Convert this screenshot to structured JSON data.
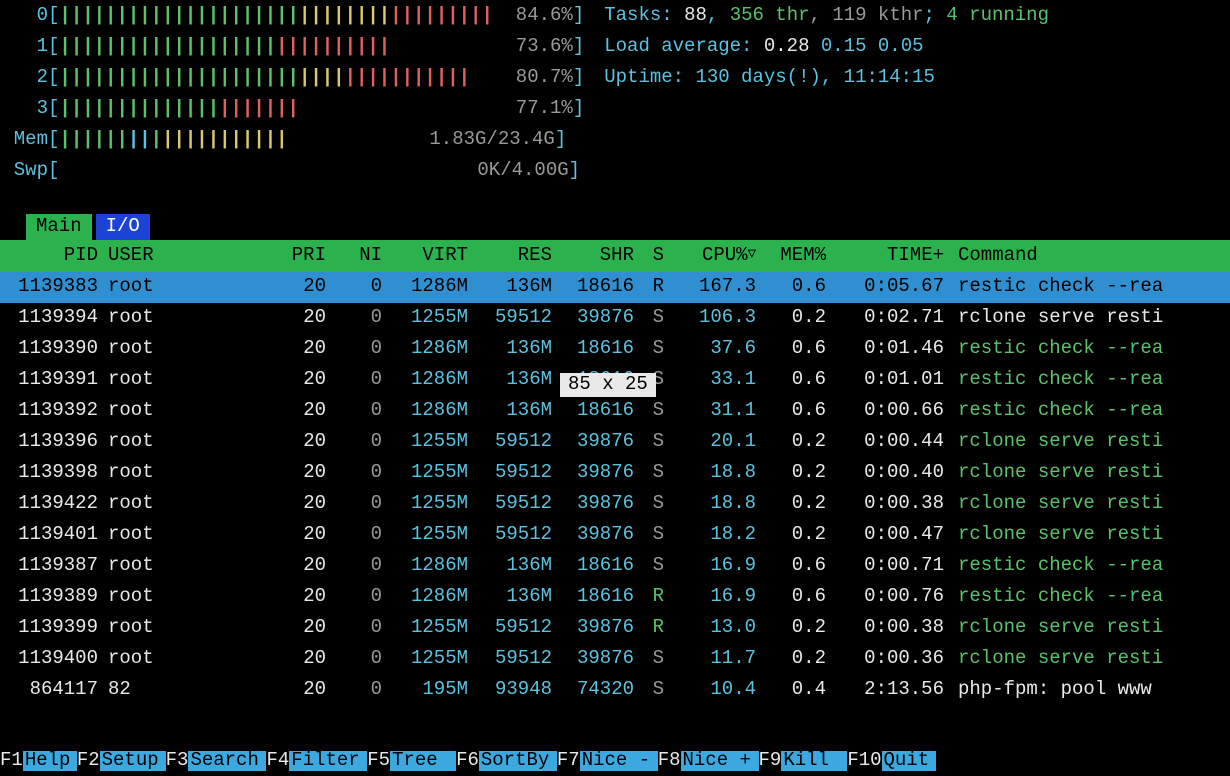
{
  "cpu": [
    {
      "label": "0",
      "pct": "84.6%",
      "bar": "GGGGGGGGGGGGGGGGGGGGGYYYYYYYYRRRRRRRRR"
    },
    {
      "label": "1",
      "pct": "73.6%",
      "bar": "GGGGGGGGGGGGGGGGGGGRRRRRRRRRR"
    },
    {
      "label": "2",
      "pct": "80.7%",
      "bar": "GGGGGGGGGGGGGGGGGGGGGYYYYRRRRRRRRRRR"
    },
    {
      "label": "3",
      "pct": "77.1%",
      "bar": "GGGGGGGGGGGGGGRRRRRRR"
    }
  ],
  "mem": {
    "label": "Mem",
    "used": "1.83G",
    "total": "23.4G",
    "bar": "GGGGGGBBGYYYYYYYYYYY"
  },
  "swp": {
    "label": "Swp",
    "used": "0K",
    "total": "4.00G"
  },
  "tasks": {
    "label": "Tasks:",
    "tasks": "88",
    "thr": "356 thr",
    "kthr": "119 kthr",
    "running": "4 running"
  },
  "load": {
    "label": "Load average:",
    "v1": "0.28",
    "v2": "0.15",
    "v3": "0.05"
  },
  "uptime": {
    "label": "Uptime:",
    "value": "130 days(!), 11:14:15"
  },
  "tabs": {
    "main": "Main",
    "io": "I/O"
  },
  "overlay": "85 x 25",
  "columns": [
    "PID",
    "USER",
    "PRI",
    "NI",
    "VIRT",
    "RES",
    "SHR",
    "S",
    "CPU%",
    "MEM%",
    "TIME+",
    "Command"
  ],
  "processes": [
    {
      "pid": "1139383",
      "user": "root",
      "pri": "20",
      "ni": "0",
      "virt": "1286M",
      "res": "136M",
      "shr": "18616",
      "s": "R",
      "cpu": "167.3",
      "mem": "0.6",
      "time": "0:05.67",
      "cmd": "restic check --rea",
      "sel": true,
      "cmd_green": false
    },
    {
      "pid": "1139394",
      "user": "root",
      "pri": "20",
      "ni": "0",
      "virt": "1255M",
      "res": "59512",
      "shr": "39876",
      "s": "S",
      "cpu": "106.3",
      "mem": "0.2",
      "time": "0:02.71",
      "cmd": "rclone serve resti",
      "cmd_green": false
    },
    {
      "pid": "1139390",
      "user": "root",
      "pri": "20",
      "ni": "0",
      "virt": "1286M",
      "res": "136M",
      "shr": "18616",
      "s": "S",
      "cpu": "37.6",
      "mem": "0.6",
      "time": "0:01.46",
      "cmd": "restic check --rea",
      "cmd_green": true
    },
    {
      "pid": "1139391",
      "user": "root",
      "pri": "20",
      "ni": "0",
      "virt": "1286M",
      "res": "136M",
      "shr": "18616",
      "s": "S",
      "cpu": "33.1",
      "mem": "0.6",
      "time": "0:01.01",
      "cmd": "restic check --rea",
      "cmd_green": true
    },
    {
      "pid": "1139392",
      "user": "root",
      "pri": "20",
      "ni": "0",
      "virt": "1286M",
      "res": "136M",
      "shr": "18616",
      "s": "S",
      "cpu": "31.1",
      "mem": "0.6",
      "time": "0:00.66",
      "cmd": "restic check --rea",
      "cmd_green": true
    },
    {
      "pid": "1139396",
      "user": "root",
      "pri": "20",
      "ni": "0",
      "virt": "1255M",
      "res": "59512",
      "shr": "39876",
      "s": "S",
      "cpu": "20.1",
      "mem": "0.2",
      "time": "0:00.44",
      "cmd": "rclone serve resti",
      "cmd_green": true
    },
    {
      "pid": "1139398",
      "user": "root",
      "pri": "20",
      "ni": "0",
      "virt": "1255M",
      "res": "59512",
      "shr": "39876",
      "s": "S",
      "cpu": "18.8",
      "mem": "0.2",
      "time": "0:00.40",
      "cmd": "rclone serve resti",
      "cmd_green": true
    },
    {
      "pid": "1139422",
      "user": "root",
      "pri": "20",
      "ni": "0",
      "virt": "1255M",
      "res": "59512",
      "shr": "39876",
      "s": "S",
      "cpu": "18.8",
      "mem": "0.2",
      "time": "0:00.38",
      "cmd": "rclone serve resti",
      "cmd_green": true
    },
    {
      "pid": "1139401",
      "user": "root",
      "pri": "20",
      "ni": "0",
      "virt": "1255M",
      "res": "59512",
      "shr": "39876",
      "s": "S",
      "cpu": "18.2",
      "mem": "0.2",
      "time": "0:00.47",
      "cmd": "rclone serve resti",
      "cmd_green": true
    },
    {
      "pid": "1139387",
      "user": "root",
      "pri": "20",
      "ni": "0",
      "virt": "1286M",
      "res": "136M",
      "shr": "18616",
      "s": "S",
      "cpu": "16.9",
      "mem": "0.6",
      "time": "0:00.71",
      "cmd": "restic check --rea",
      "cmd_green": true
    },
    {
      "pid": "1139389",
      "user": "root",
      "pri": "20",
      "ni": "0",
      "virt": "1286M",
      "res": "136M",
      "shr": "18616",
      "s": "R",
      "cpu": "16.9",
      "mem": "0.6",
      "time": "0:00.76",
      "cmd": "restic check --rea",
      "cmd_green": true
    },
    {
      "pid": "1139399",
      "user": "root",
      "pri": "20",
      "ni": "0",
      "virt": "1255M",
      "res": "59512",
      "shr": "39876",
      "s": "R",
      "cpu": "13.0",
      "mem": "0.2",
      "time": "0:00.38",
      "cmd": "rclone serve resti",
      "cmd_green": true
    },
    {
      "pid": "1139400",
      "user": "root",
      "pri": "20",
      "ni": "0",
      "virt": "1255M",
      "res": "59512",
      "shr": "39876",
      "s": "S",
      "cpu": "11.7",
      "mem": "0.2",
      "time": "0:00.36",
      "cmd": "rclone serve resti",
      "cmd_green": true
    },
    {
      "pid": "864117",
      "user": "82",
      "pri": "20",
      "ni": "0",
      "virt": "195M",
      "res": "93948",
      "shr": "74320",
      "s": "S",
      "cpu": "10.4",
      "mem": "0.4",
      "time": "2:13.56",
      "cmd": "php-fpm: pool www",
      "cmd_green": false
    }
  ],
  "fkeys": [
    {
      "k": "F1",
      "l": "Help"
    },
    {
      "k": "F2",
      "l": "Setup"
    },
    {
      "k": "F3",
      "l": "Search"
    },
    {
      "k": "F4",
      "l": "Filter"
    },
    {
      "k": "F5",
      "l": "Tree"
    },
    {
      "k": "F6",
      "l": "SortBy"
    },
    {
      "k": "F7",
      "l": "Nice -"
    },
    {
      "k": "F8",
      "l": "Nice +"
    },
    {
      "k": "F9",
      "l": "Kill"
    },
    {
      "k": "F10",
      "l": "Quit"
    }
  ]
}
